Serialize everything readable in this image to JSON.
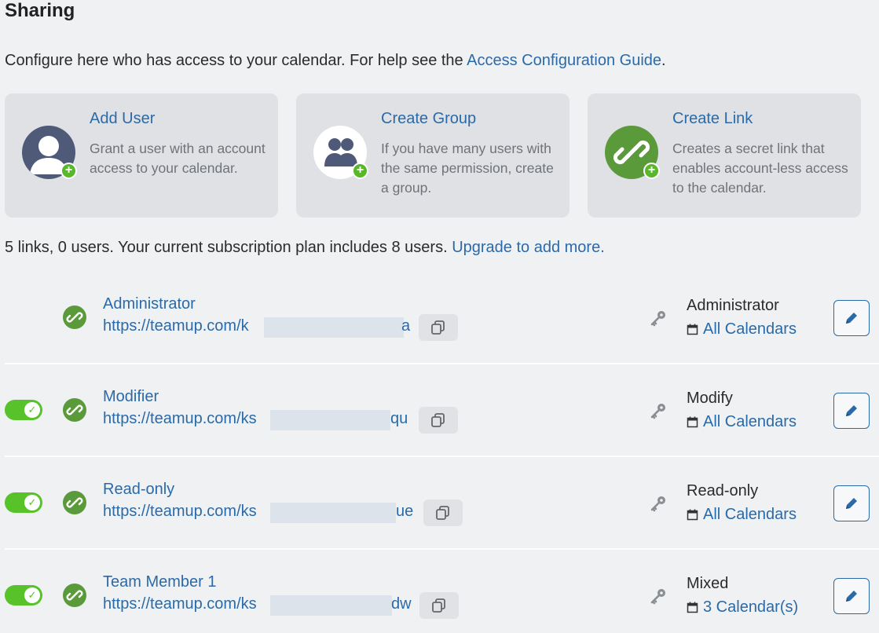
{
  "page": {
    "title": "Sharing",
    "intro_text": "Configure here who has access to your calendar. For help see the ",
    "intro_link": "Access Configuration Guide",
    "intro_end": "."
  },
  "cards": [
    {
      "title": "Add User",
      "description": "Grant a user with an account access to your calendar.",
      "icon": "user-icon"
    },
    {
      "title": "Create Group",
      "description": "If you have many users with the same permission, create a group.",
      "icon": "group-icon"
    },
    {
      "title": "Create Link",
      "description": "Creates a secret link that enables account-less access to the calendar.",
      "icon": "link-icon"
    }
  ],
  "summary": {
    "text": "5 links, 0 users. Your current subscription plan includes 8 users. ",
    "link": "Upgrade to add more."
  },
  "rows": [
    {
      "name": "Administrator",
      "url_start": "https://teamup.com/k",
      "url_end": "a",
      "permission": "Administrator",
      "calendars": "All Calendars",
      "toggle": null
    },
    {
      "name": "Modifier",
      "url_start": "https://teamup.com/ks",
      "url_end": "qu",
      "permission": "Modify",
      "calendars": "All Calendars",
      "toggle": "on"
    },
    {
      "name": "Read-only",
      "url_start": "https://teamup.com/ks",
      "url_end": "ue",
      "permission": "Read-only",
      "calendars": "All Calendars",
      "toggle": "on"
    },
    {
      "name": "Team Member 1",
      "url_start": "https://teamup.com/ks",
      "url_end": "dw",
      "permission": "Mixed",
      "calendars": "3 Calendar(s)",
      "toggle": "on"
    }
  ],
  "colors": {
    "accent": "#2a6aa8",
    "toggle_on": "#57c22a",
    "link_icon": "#5a9a3a",
    "add_badge": "#58b82a"
  }
}
